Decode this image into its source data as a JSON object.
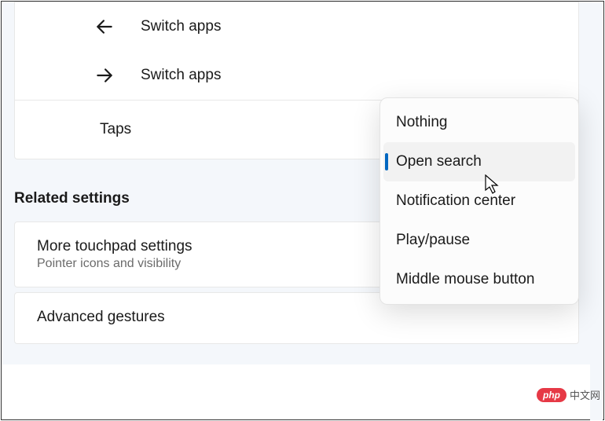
{
  "gestures": {
    "back": {
      "label": "Switch apps"
    },
    "forward": {
      "label": "Switch apps"
    }
  },
  "taps": {
    "label": "Taps"
  },
  "dropdown": {
    "items": [
      {
        "label": "Nothing"
      },
      {
        "label": "Open search"
      },
      {
        "label": "Notification center"
      },
      {
        "label": "Play/pause"
      },
      {
        "label": "Middle mouse button"
      }
    ]
  },
  "related": {
    "header": "Related settings",
    "more": {
      "title": "More touchpad settings",
      "subtitle": "Pointer icons and visibility"
    },
    "advanced": {
      "title": "Advanced gestures"
    }
  },
  "watermark": {
    "badge": "php",
    "text": "中文网"
  }
}
